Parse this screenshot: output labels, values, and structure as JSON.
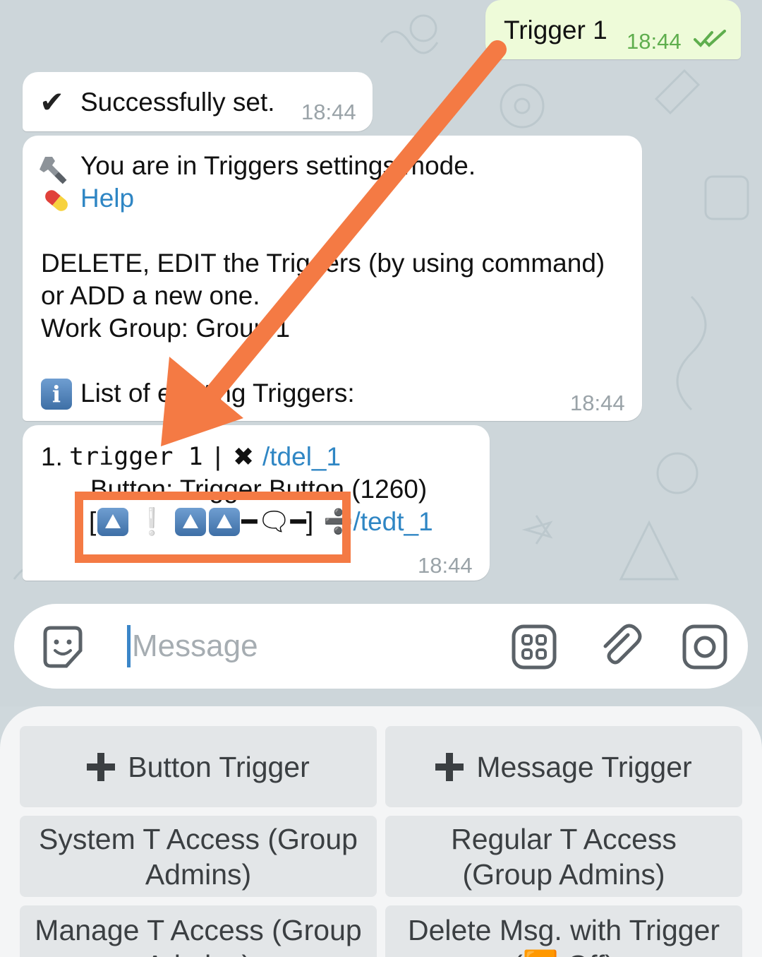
{
  "messages": {
    "outgoing": {
      "text": "Trigger 1",
      "time": "18:44"
    },
    "success": {
      "check": "✔",
      "text": "Successfully set.",
      "time": "18:44"
    },
    "settings": {
      "line1_icon": "wrench-icon",
      "line1": "You are in Triggers settings mode.",
      "help_icon": "pill-icon",
      "help": "Help",
      "line3": "DELETE, EDIT the Triggers (by using command)",
      "line4": "or ADD a new one.",
      "line5": "Work Group: Group 1",
      "info_icon": "info-icon",
      "line6": "List of existing Triggers:",
      "time": "18:44"
    },
    "trigger_list": {
      "item_prefix": "1.",
      "item_name": "trigger 1",
      "separator": "|",
      "delete_symbol": "✖",
      "delete_command": "/tdel_1",
      "button_line": "Button: Trigger Button (1260)",
      "bracket_open": "[",
      "exclaim": "❕",
      "dash1": "━",
      "speech": "🗨",
      "dash2": "━",
      "bracket_close": "]",
      "edit_symbol": "➗",
      "edit_command": "/tedt_1",
      "time": "18:44"
    }
  },
  "input": {
    "placeholder": "Message"
  },
  "keyboard": {
    "buttons": [
      {
        "label": "Button Trigger",
        "plus": true
      },
      {
        "label": "Message Trigger",
        "plus": true
      },
      {
        "label": "System T Access (Group Admins)"
      },
      {
        "label": "Regular T Access (Group Admins)"
      },
      {
        "label": "Manage T Access (Group Admins)"
      },
      {
        "label": "Delete Msg. with Trigger (🔽 Off)"
      }
    ]
  },
  "colors": {
    "accent_link": "#2f86c4",
    "annotation": "#f47a44",
    "outgoing_bubble": "#eefbd9"
  }
}
